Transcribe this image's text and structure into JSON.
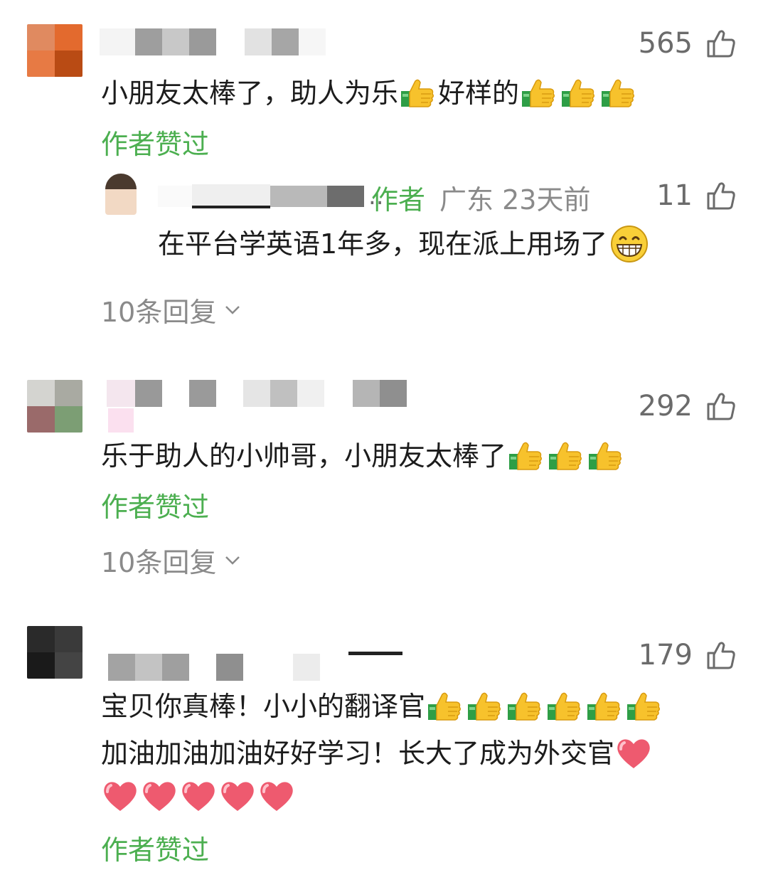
{
  "comments": [
    {
      "likes": "565",
      "text": "小朋友太棒了，助人为乐",
      "text2": "好样的",
      "author_liked": "作者赞过",
      "reply": {
        "author_tag": "作者",
        "location_time": "广东 23天前",
        "likes": "11",
        "text": "在平台学英语1年多，现在派上用场了"
      },
      "replies_label": "10条回复"
    },
    {
      "likes": "292",
      "text": "乐于助人的小帅哥，小朋友太棒了",
      "author_liked": "作者赞过",
      "replies_label": "10条回复"
    },
    {
      "likes": "179",
      "text_line1": "宝贝你真棒！小小的翻译官",
      "text_line2": "加油加油加油好好学习！长大了成为外交官",
      "author_liked": "作者赞过"
    }
  ],
  "icons": {
    "like": "thumbs-up-outline-icon",
    "emoji_thumbs": "thumbs-up-emoji",
    "emoji_grin": "grinning-face-emoji",
    "emoji_heart": "heart-emoji",
    "expand": "chevron-down-icon"
  },
  "colors": {
    "author_green": "#4caf50",
    "muted_gray": "#8a8a8a"
  }
}
